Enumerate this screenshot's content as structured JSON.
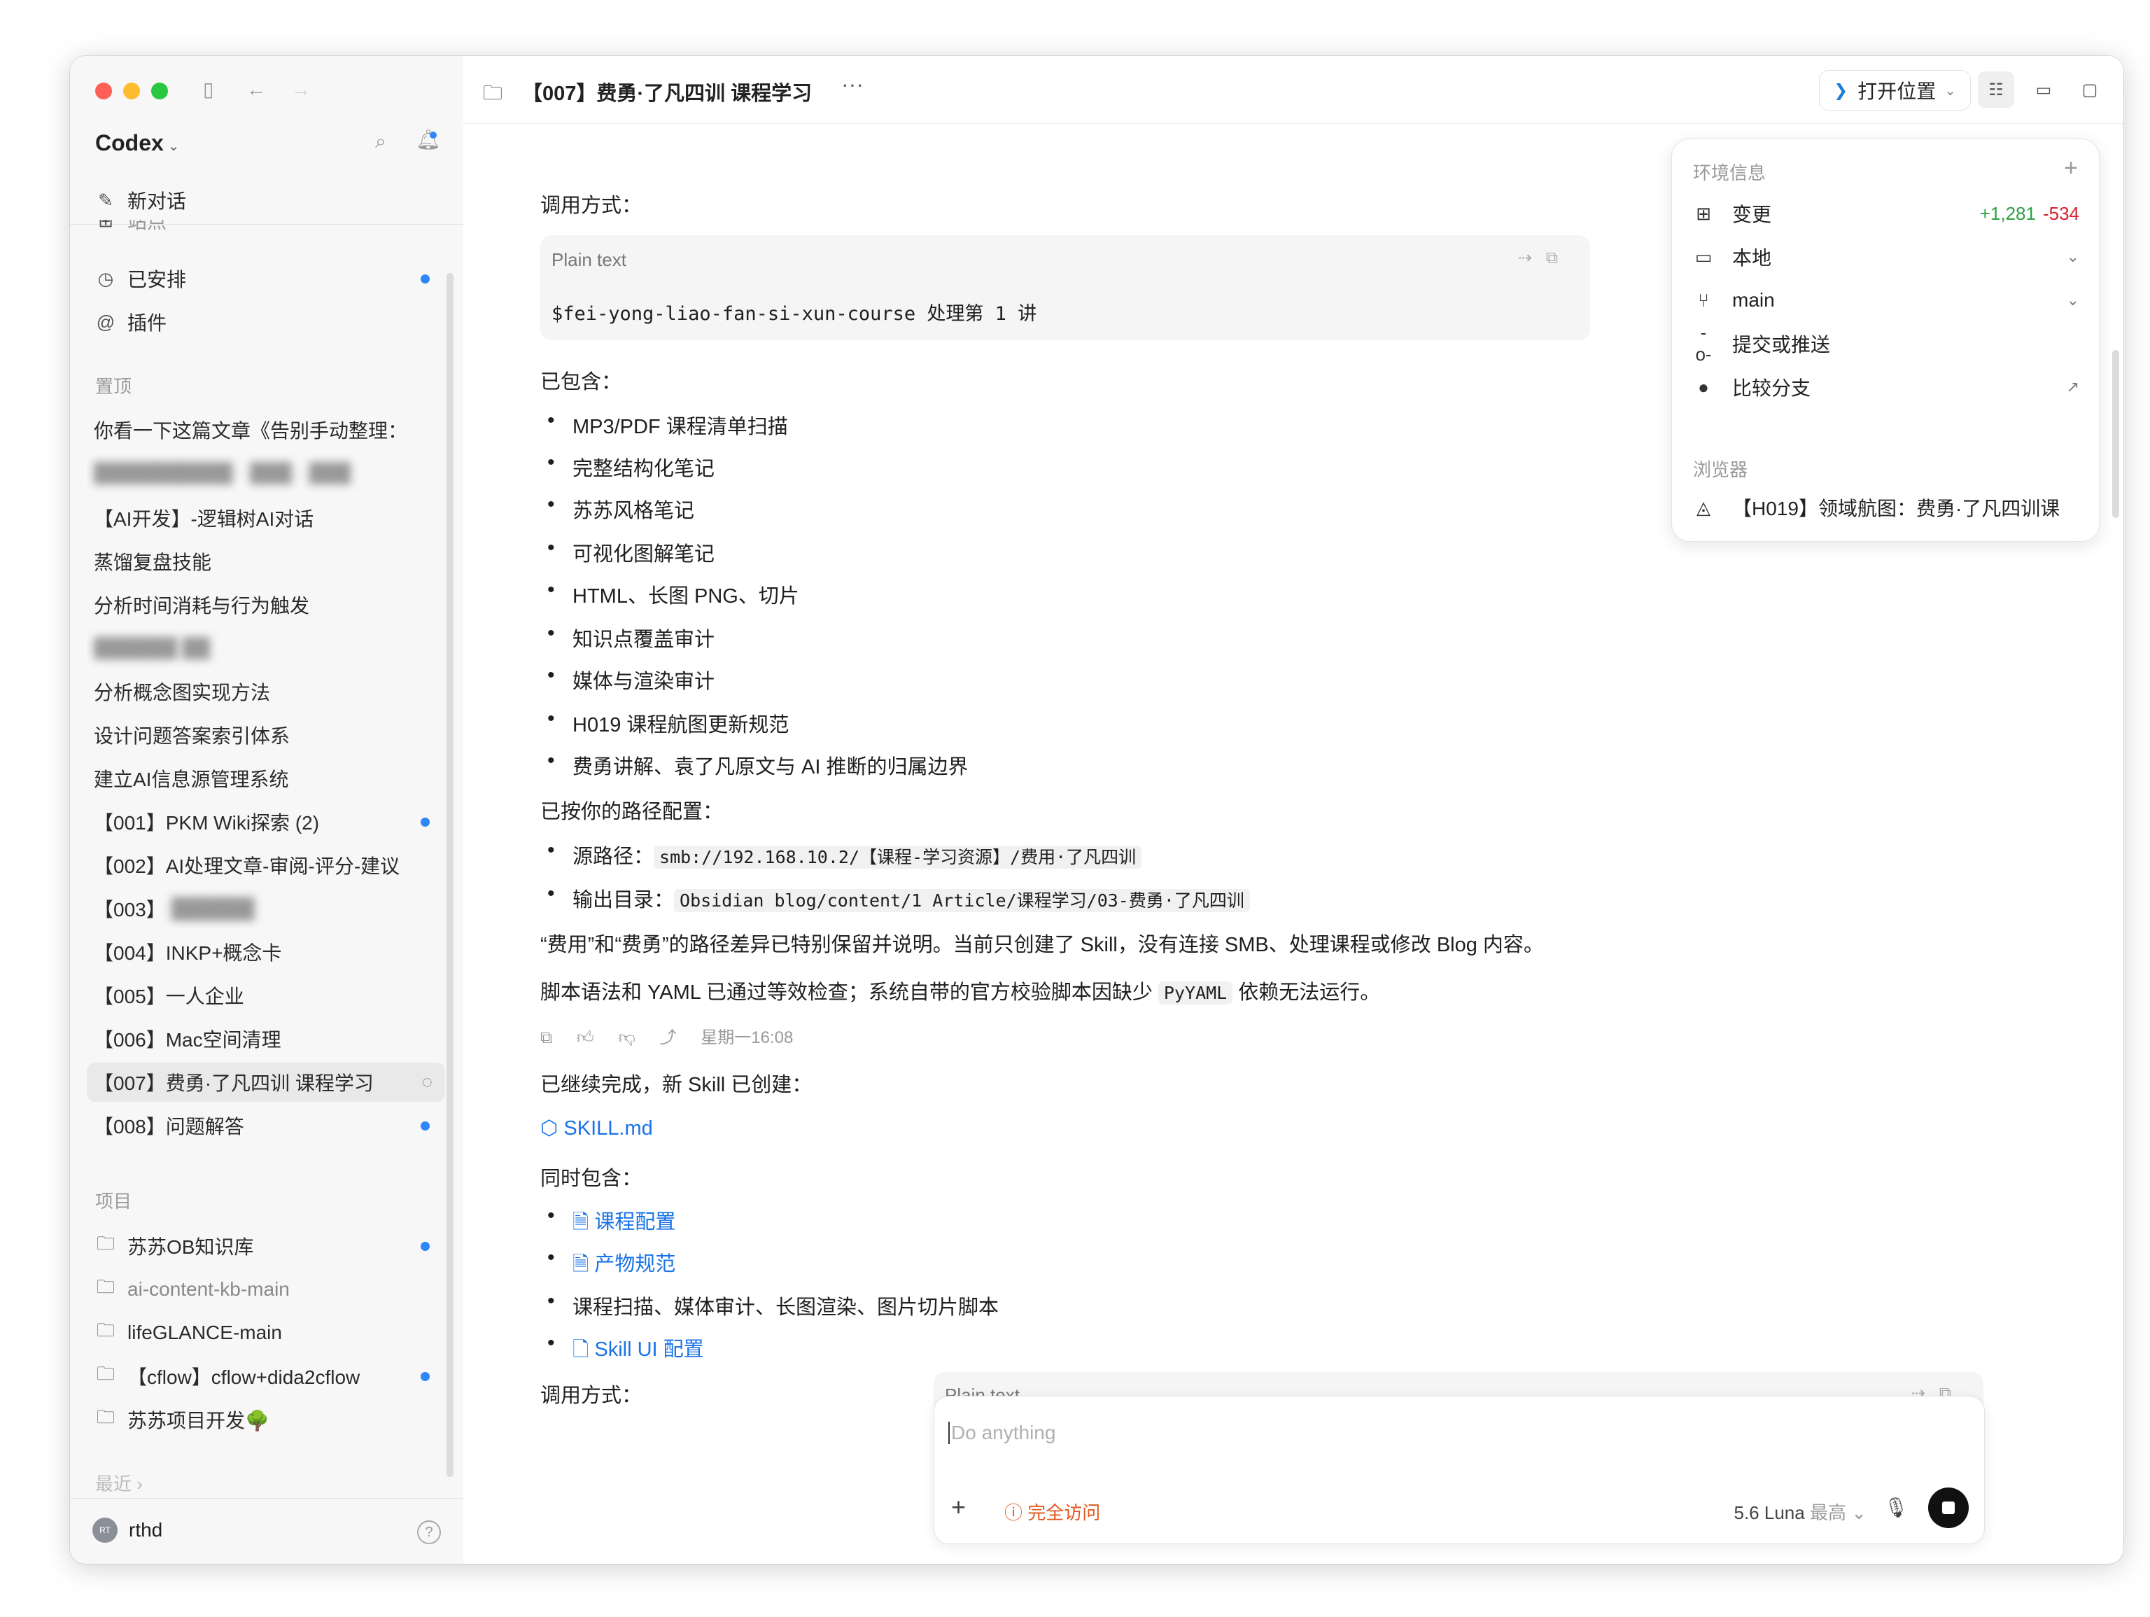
{
  "sidebar": {
    "app_name": "Codex",
    "new_chat": "新对话",
    "partial_item": "站点",
    "scheduled": "已安排",
    "plugins": "插件",
    "pinned_header": "置顶",
    "pinned": [
      "你看一下这篇文章《告别手动整理：",
      "【AI开发】-逻辑树AI对话",
      "蒸馏复盘技能",
      "分析时间消耗与行为触发",
      "分析概念图实现方法",
      "设计问题答案索引体系",
      "建立AI信息源管理系统",
      "【001】PKM Wiki探索 (2)",
      "【002】AI处理文章-审阅-评分-建议",
      "【003】",
      "【004】INKP+概念卡",
      "【005】一人企业",
      "【006】Mac空间清理",
      "【007】费勇·了凡四训 课程学习",
      "【008】问题解答"
    ],
    "projects_header": "项目",
    "projects": [
      "苏苏OB知识库",
      "ai-content-kb-main",
      "lifeGLANCE-main",
      "【cflow】cflow+dida2cflow",
      "苏苏项目开发🌳"
    ],
    "recent_header": "最近",
    "user": {
      "name": "rthd",
      "initials": "RT"
    }
  },
  "topbar": {
    "title": "【007】费勇·了凡四训 课程学习",
    "open_location": "打开位置"
  },
  "content": {
    "invoke_label_1": "调用方式：",
    "code_lang": "Plain text",
    "code_1": "$fei-yong-liao-fan-si-xun-course 处理第 1 讲",
    "included_label": "已包含：",
    "included": [
      "MP3/PDF 课程清单扫描",
      "完整结构化笔记",
      "苏苏风格笔记",
      "可视化图解笔记",
      "HTML、长图 PNG、切片",
      "知识点覆盖审计",
      "媒体与渲染审计",
      "H019 课程航图更新规范",
      "费勇讲解、袁了凡原文与 AI 推断的归属边界"
    ],
    "paths_label": "已按你的路径配置：",
    "source_label": "源路径：",
    "source_path": "smb://192.168.10.2/【课程-学习资源】/费用·了凡四训",
    "output_label": "输出目录：",
    "output_path": "Obsidian blog/content/1 Article/课程学习/03-费勇·了凡四训",
    "note_1": "“费用”和“费勇”的路径差异已特别保留并说明。当前只创建了 Skill，没有连接 SMB、处理课程或修改 Blog 内容。",
    "note_2_pre": "脚本语法和 YAML 已通过等效检查；系统自带的官方校验脚本因缺少",
    "note_2_code": "PyYAML",
    "note_2_post": "依赖无法运行。",
    "timestamp": "星期一16:08",
    "done_label": "已继续完成，新 Skill 已创建：",
    "skill_link": "SKILL.md",
    "also_label": "同时包含：",
    "also": [
      {
        "text": "课程配置",
        "link": true
      },
      {
        "text": "产物规范",
        "link": true
      },
      {
        "text": "课程扫描、媒体审计、长图渲染、图片切片脚本",
        "link": false
      },
      {
        "text": "Skill UI 配置",
        "link": true
      }
    ],
    "invoke_label_2": "调用方式："
  },
  "composer": {
    "placeholder": "Do anything",
    "access": "完全访问",
    "model": "5.6 Luna",
    "level": "最高"
  },
  "env_panel": {
    "title": "环境信息",
    "changes_label": "变更",
    "additions": "+1,281",
    "deletions": "-534",
    "local": "本地",
    "branch": "main",
    "commit_push": "提交或推送",
    "compare": "比较分支",
    "browser_title": "浏览器",
    "browser_tab": "【H019】领域航图：费勇·了凡四训课"
  }
}
